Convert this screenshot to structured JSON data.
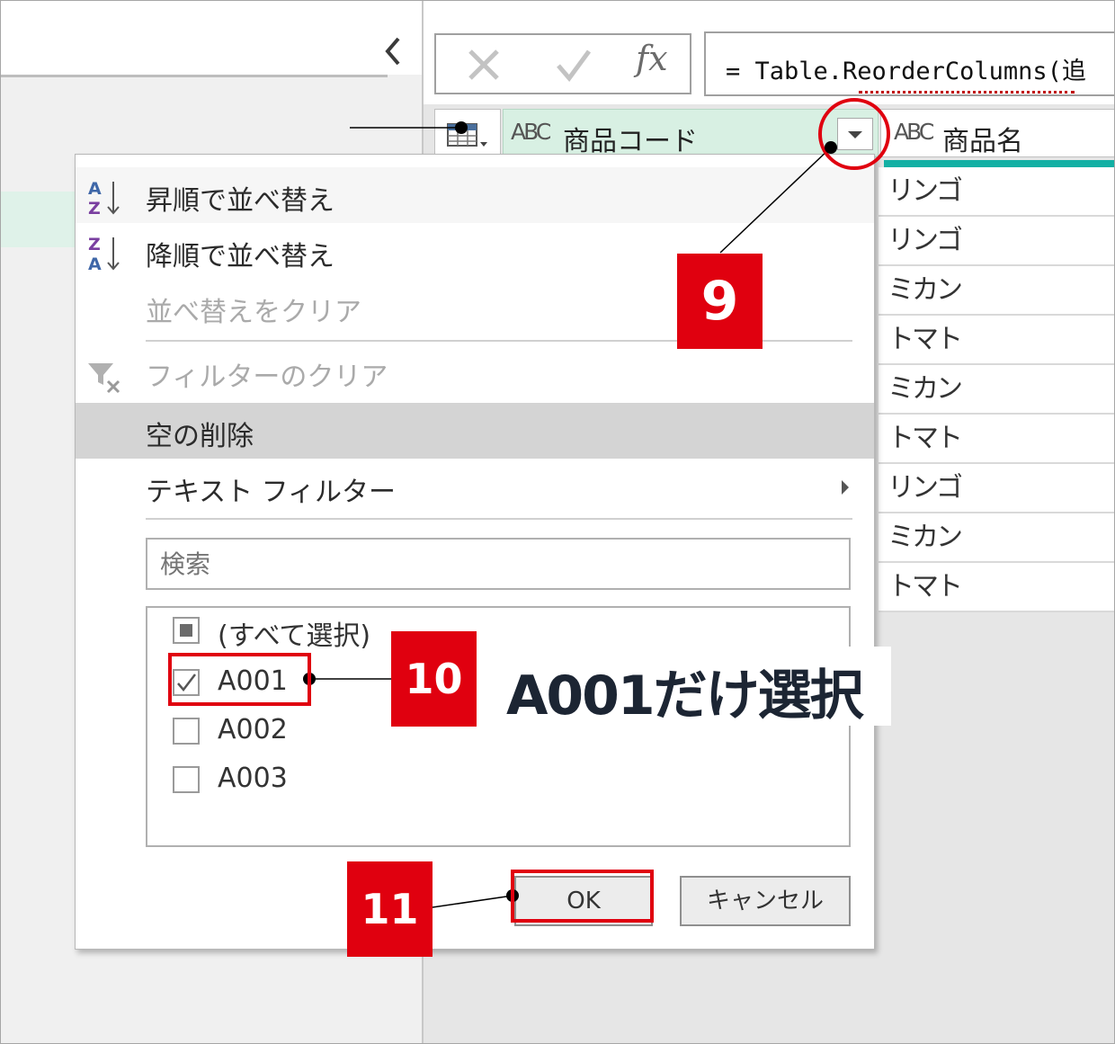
{
  "formula_bar": {
    "fx_label": "fx",
    "formula": "= Table.ReorderColumns(追"
  },
  "columns": [
    {
      "type": "ABC",
      "name": "商品コード"
    },
    {
      "type": "ABC",
      "name": "商品名"
    }
  ],
  "product_names": [
    "リンゴ",
    "リンゴ",
    "ミカン",
    "トマト",
    "ミカン",
    "トマト",
    "リンゴ",
    "ミカン",
    "トマト"
  ],
  "menu": {
    "sort_asc": "昇順で並べ替え",
    "sort_desc": "降順で並べ替え",
    "clear_sort": "並べ替えをクリア",
    "clear_filter": "フィルターのクリア",
    "remove_empty": "空の削除",
    "text_filter": "テキスト フィルター",
    "search_placeholder": "検索",
    "select_all": "(すべて選択)",
    "values": [
      {
        "label": "A001",
        "checked": true
      },
      {
        "label": "A002",
        "checked": false
      },
      {
        "label": "A003",
        "checked": false
      }
    ],
    "ok_label": "OK",
    "cancel_label": "キャンセル"
  },
  "annotations": {
    "step9": "9",
    "step10": "10",
    "step11": "11",
    "callout": "A001だけ選択"
  },
  "colors": {
    "annotation_red": "#e0000f",
    "header_green": "#d8f0e3",
    "accent_teal": "#12b0a4"
  }
}
